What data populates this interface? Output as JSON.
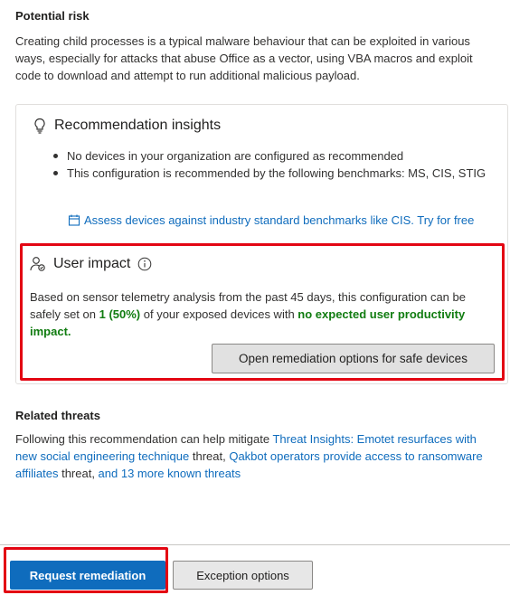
{
  "potential_risk": {
    "heading": "Potential risk",
    "text": "Creating child processes is a typical malware behaviour that can be exploited in various ways, especially for attacks that abuse Office as a vector, using VBA macros and exploit code to download and attempt to run additional malicious payload."
  },
  "insights": {
    "icon": "lightbulb-icon",
    "title": "Recommendation insights",
    "bullets": [
      "No devices in your organization are configured as recommended",
      "This configuration is recommended by the following benchmarks: MS, CIS, STIG"
    ],
    "assess_link": "Assess devices against industry standard benchmarks like CIS. Try for free"
  },
  "user_impact": {
    "icon": "user-impact-icon",
    "title": "User impact",
    "text_before": "Based on sensor telemetry analysis from the past 45 days, this configuration can be safely set on ",
    "highlight_count": "1 (50%)",
    "text_middle": " of your exposed devices with ",
    "highlight_impact": "no expected user productivity impact.",
    "button_label": "Open remediation options for safe devices"
  },
  "related_threats": {
    "heading": "Related threats",
    "text_1": "Following this recommendation can help mitigate ",
    "link_1": "Threat Insights: Emotet resurfaces with new social engineering technique",
    "text_2": " threat, ",
    "link_2": "Qakbot operators provide access to ransomware affiliates",
    "text_3": " threat, ",
    "link_3": "and 13 more known threats"
  },
  "footer": {
    "request_button": "Request remediation",
    "exception_button": "Exception options"
  },
  "colors": {
    "link": "#0f6cbd",
    "primary_button": "#0f6cbd",
    "positive_text": "#107c10",
    "highlight_outline": "#e30613"
  }
}
